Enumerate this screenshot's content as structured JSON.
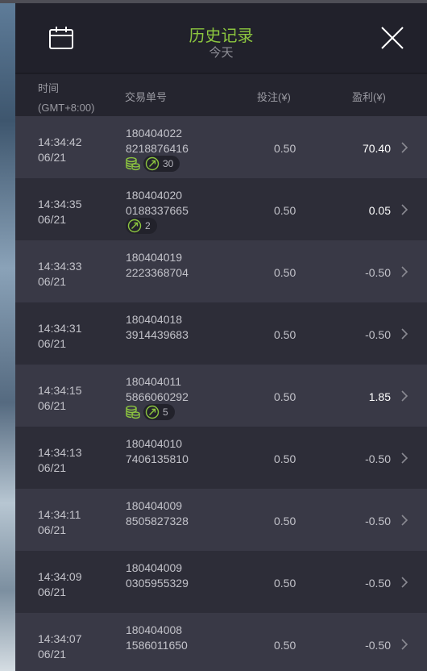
{
  "header": {
    "title": "历史记录",
    "subtitle": "今天"
  },
  "columns": {
    "time_line1": "时间",
    "time_line2": "(GMT+8:00)",
    "order": "交易单号",
    "bet": "投注(¥)",
    "profit": "盈利(¥)"
  },
  "rows": [
    {
      "time": "14:34:42",
      "date": "06/21",
      "order1": "180404022",
      "order2": "8218876416",
      "bet": "0.50",
      "profit": "70.40",
      "positive": true,
      "coin": true,
      "multiplier": "30"
    },
    {
      "time": "14:34:35",
      "date": "06/21",
      "order1": "180404020",
      "order2": "0188337665",
      "bet": "0.50",
      "profit": "0.05",
      "positive": true,
      "coin": false,
      "multiplier": "2"
    },
    {
      "time": "14:34:33",
      "date": "06/21",
      "order1": "180404019",
      "order2": "2223368704",
      "bet": "0.50",
      "profit": "-0.50",
      "positive": false
    },
    {
      "time": "14:34:31",
      "date": "06/21",
      "order1": "180404018",
      "order2": "3914439683",
      "bet": "0.50",
      "profit": "-0.50",
      "positive": false
    },
    {
      "time": "14:34:15",
      "date": "06/21",
      "order1": "180404011",
      "order2": "5866060292",
      "bet": "0.50",
      "profit": "1.85",
      "positive": true,
      "coin": true,
      "multiplier": "5"
    },
    {
      "time": "14:34:13",
      "date": "06/21",
      "order1": "180404010",
      "order2": "7406135810",
      "bet": "0.50",
      "profit": "-0.50",
      "positive": false
    },
    {
      "time": "14:34:11",
      "date": "06/21",
      "order1": "180404009",
      "order2": "8505827328",
      "bet": "0.50",
      "profit": "-0.50",
      "positive": false
    },
    {
      "time": "14:34:09",
      "date": "06/21",
      "order1": "180404009",
      "order2": "0305955329",
      "bet": "0.50",
      "profit": "-0.50",
      "positive": false
    },
    {
      "time": "14:34:07",
      "date": "06/21",
      "order1": "180404008",
      "order2": "1586011650",
      "bet": "0.50",
      "profit": "-0.50",
      "positive": false
    }
  ],
  "icons": {
    "calendar": "calendar-icon",
    "close": "close-icon",
    "chevron": "chevron-right-icon",
    "coin": "coin-stack-icon",
    "multiplier": "multiplier-icon"
  },
  "colors": {
    "accent": "#8cc63f",
    "background": "#2c2c36",
    "header": "#21212b",
    "row_alt": "#393946"
  }
}
